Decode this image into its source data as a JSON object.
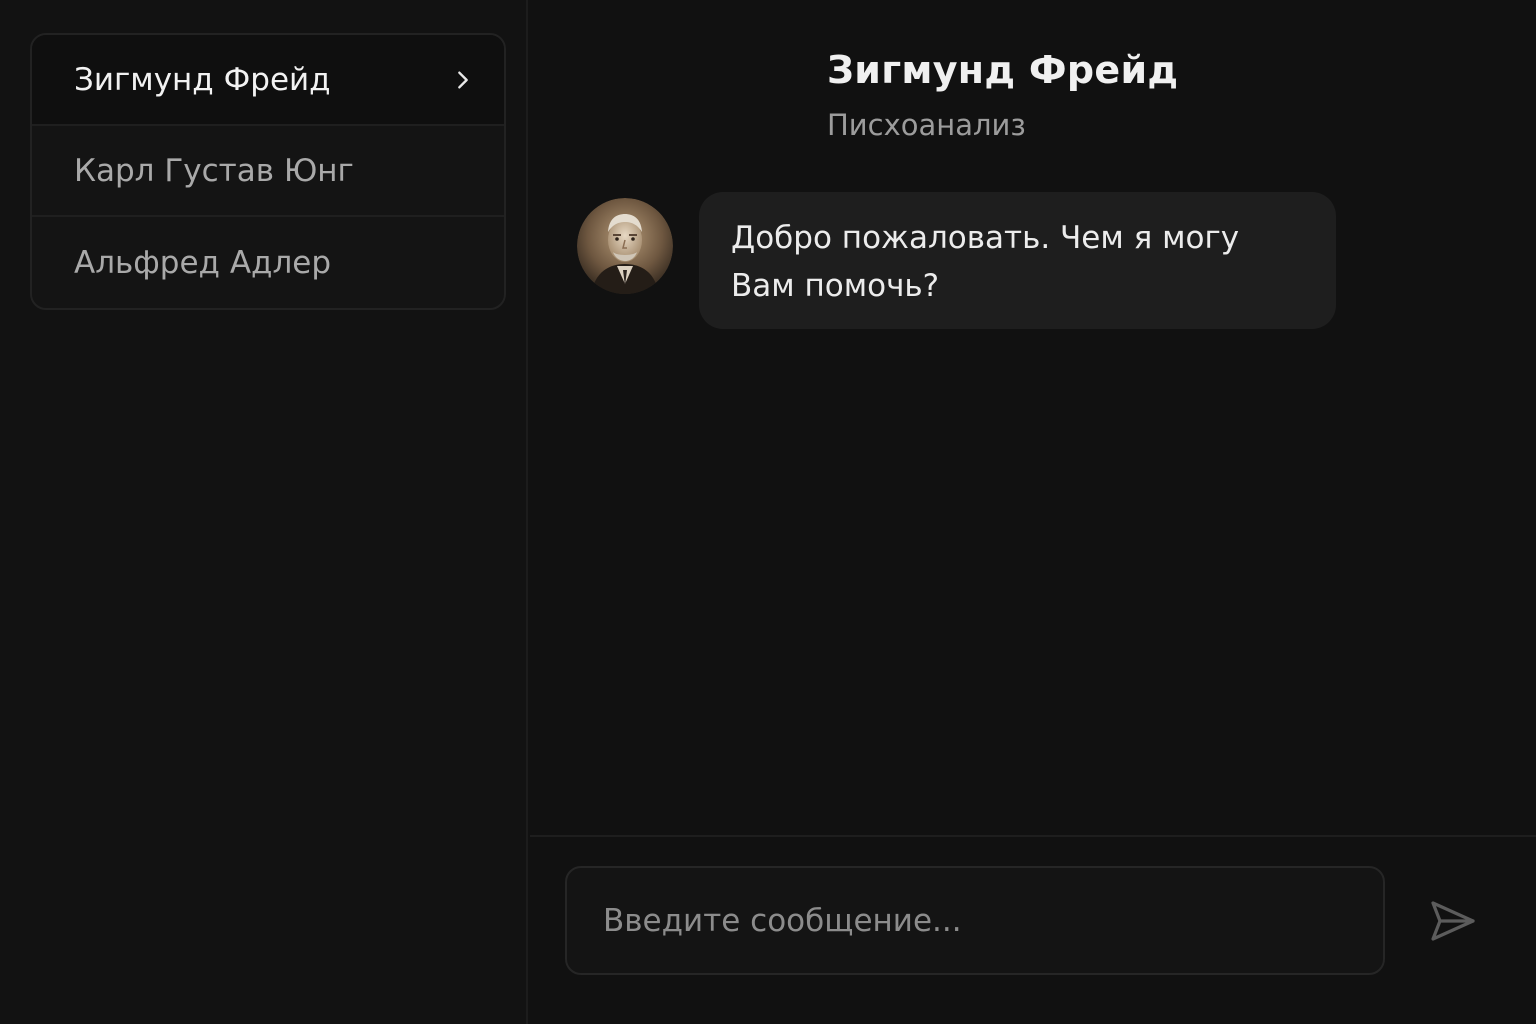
{
  "sidebar": {
    "contacts": [
      {
        "name": "Зигмунд Фрейд",
        "active": true
      },
      {
        "name": "Карл Густав Юнг",
        "active": false
      },
      {
        "name": "Альфред Адлер",
        "active": false
      }
    ]
  },
  "chat": {
    "title": "Зигмунд Фрейд",
    "subtitle": "Писхоанализ",
    "messages": [
      {
        "from": "assistant",
        "avatar": "portrait-avatar",
        "text_line1": "Добро пожаловать. Чем я могу",
        "text_line2": "Вам помочь?"
      }
    ]
  },
  "composer": {
    "placeholder": "Введите сообщение...",
    "value": "",
    "send_icon": "send-icon"
  },
  "colors": {
    "background": "#111111",
    "panel": "#141414",
    "bubble": "#1e1e1e",
    "text_primary": "#f0f0f0",
    "text_secondary": "#9c9c9c"
  }
}
